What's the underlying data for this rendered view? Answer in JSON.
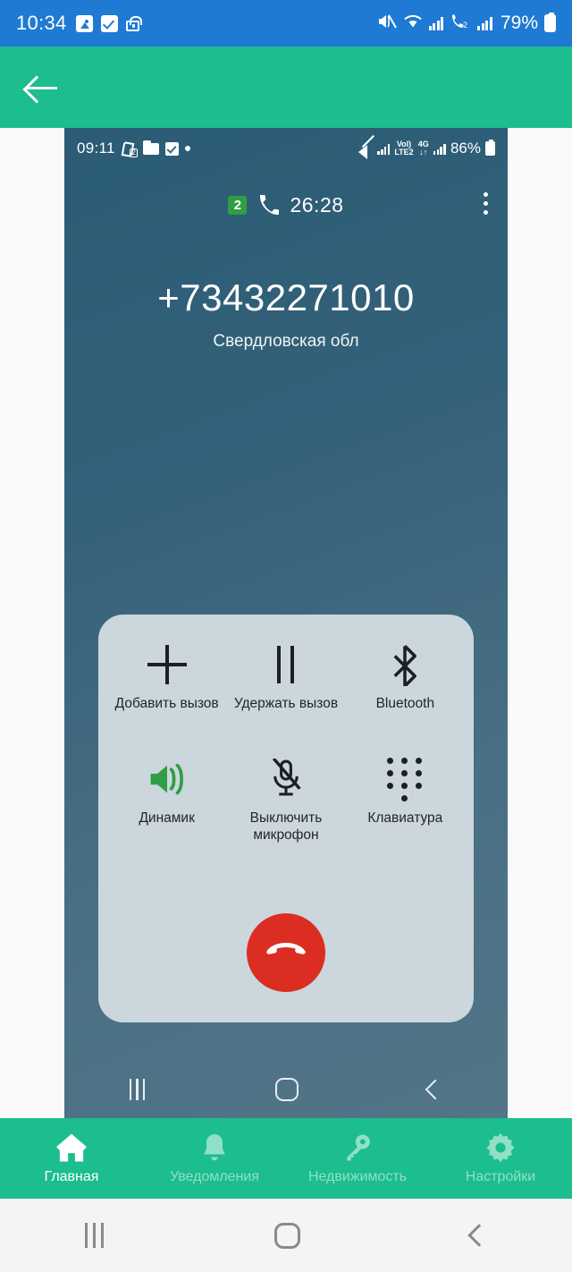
{
  "system_status_bar": {
    "time": "10:34",
    "battery_percent": "79%",
    "left_icons": [
      "image-icon",
      "checkbox-icon",
      "lock-icon"
    ],
    "right_icons": [
      "mute-icon",
      "wifi-icon",
      "signal-icon",
      "call-sim2-icon",
      "signal-icon",
      "battery-icon"
    ]
  },
  "app_bar": {
    "back_icon": "arrow-left-icon"
  },
  "screenshot": {
    "status_bar": {
      "time": "09:11",
      "battery_percent": "86%",
      "network_label_top": "Vol)",
      "network_label_bottom": "LTE2",
      "data_label_top": "4G",
      "data_label_bottom": "↓↑",
      "left_icons": [
        "call-sim2-icon",
        "folder-icon",
        "checkbox-icon",
        "dot-icon"
      ],
      "right_icons": [
        "mute-icon",
        "signal-icon",
        "volte2-icon",
        "4g-icon",
        "signal-icon",
        "battery-icon"
      ]
    },
    "call_header": {
      "sim_badge": "2",
      "phone_icon": "phone-icon",
      "duration": "26:28",
      "menu_icon": "more-vertical-icon"
    },
    "caller": {
      "number": "+73432271010",
      "location": "Свердловская обл"
    },
    "controls": [
      {
        "id": "add-call",
        "label": "Добавить вызов",
        "icon": "plus-icon",
        "active": false
      },
      {
        "id": "hold-call",
        "label": "Удержать вызов",
        "icon": "pause-icon",
        "active": false
      },
      {
        "id": "bluetooth",
        "label": "Bluetooth",
        "icon": "bluetooth-icon",
        "active": false
      },
      {
        "id": "speaker",
        "label": "Динамик",
        "icon": "speaker-icon",
        "active": true
      },
      {
        "id": "mute-mic",
        "label": "Выключить микрофон",
        "icon": "mic-off-icon",
        "active": false
      },
      {
        "id": "keypad",
        "label": "Клавиатура",
        "icon": "dialpad-icon",
        "active": false
      }
    ],
    "end_call": {
      "icon": "end-call-icon",
      "color": "#dc2d22"
    },
    "nav_bar": {
      "recent_icon": "recent-apps-icon",
      "home_icon": "home-square-icon",
      "back_icon": "back-chevron-icon"
    }
  },
  "tab_bar": {
    "items": [
      {
        "label": "Главная",
        "icon": "home-icon",
        "active": true
      },
      {
        "label": "Уведомления",
        "icon": "bell-icon",
        "active": false
      },
      {
        "label": "Недвижимость",
        "icon": "key-icon",
        "active": false
      },
      {
        "label": "Настройки",
        "icon": "gear-icon",
        "active": false
      }
    ]
  },
  "system_nav_bar": {
    "recent_icon": "recent-apps-icon",
    "home_icon": "home-square-icon",
    "back_icon": "back-chevron-icon"
  },
  "colors": {
    "status_blue": "#1f7ad4",
    "brand_green": "#1cbd8e",
    "end_call_red": "#dc2d22",
    "panel_gray": "#ccd6dd",
    "speaker_green": "#2f9e44"
  }
}
